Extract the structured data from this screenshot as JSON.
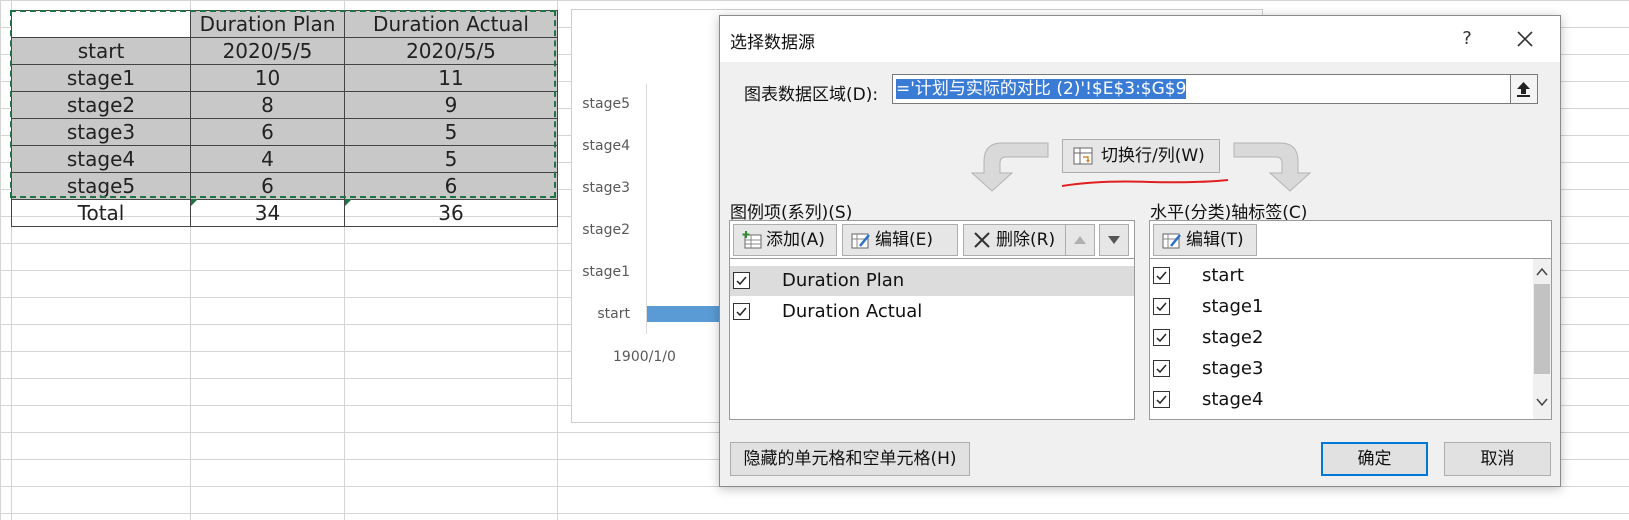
{
  "spreadsheet": {
    "headers": [
      "",
      "Duration Plan",
      "Duration Actual"
    ],
    "rows": [
      [
        "start",
        "2020/5/5",
        "2020/5/5"
      ],
      [
        "stage1",
        "10",
        "11"
      ],
      [
        "stage2",
        "8",
        "9"
      ],
      [
        "stage3",
        "6",
        "5"
      ],
      [
        "stage4",
        "4",
        "5"
      ],
      [
        "stage5",
        "6",
        "6"
      ],
      [
        "Total",
        "34",
        "36"
      ]
    ]
  },
  "chart_data": {
    "type": "bar",
    "categories": [
      "start",
      "stage1",
      "stage2",
      "stage3",
      "stage4",
      "stage5"
    ],
    "x_tick": "1900/1/0"
  },
  "dialog": {
    "title": "选择数据源",
    "help": "?",
    "range_label": "图表数据区域(D):",
    "range_value": "='计划与实际的对比 (2)'!$E$3:$G$9",
    "switch_label": "切换行/列(W)",
    "legend_section_label": "图例项(系列)(S)",
    "axis_section_label": "水平(分类)轴标签(C)",
    "add_label": "添加(A)",
    "edit_label": "编辑(E)",
    "delete_label": "删除(R)",
    "axis_edit_label": "编辑(T)",
    "series": [
      {
        "name": "Duration Plan",
        "checked": true
      },
      {
        "name": "Duration Actual",
        "checked": true
      }
    ],
    "categories": [
      {
        "name": "start",
        "checked": true
      },
      {
        "name": "stage1",
        "checked": true
      },
      {
        "name": "stage2",
        "checked": true
      },
      {
        "name": "stage3",
        "checked": true
      },
      {
        "name": "stage4",
        "checked": true
      }
    ],
    "hidden_cells_label": "隐藏的单元格和空单元格(H)",
    "ok_label": "确定",
    "cancel_label": "取消"
  },
  "colors": {
    "selection_border": "#217346",
    "bar": "#5b9bd5",
    "annotation": "#e02020",
    "default_button": "#0078d7"
  }
}
